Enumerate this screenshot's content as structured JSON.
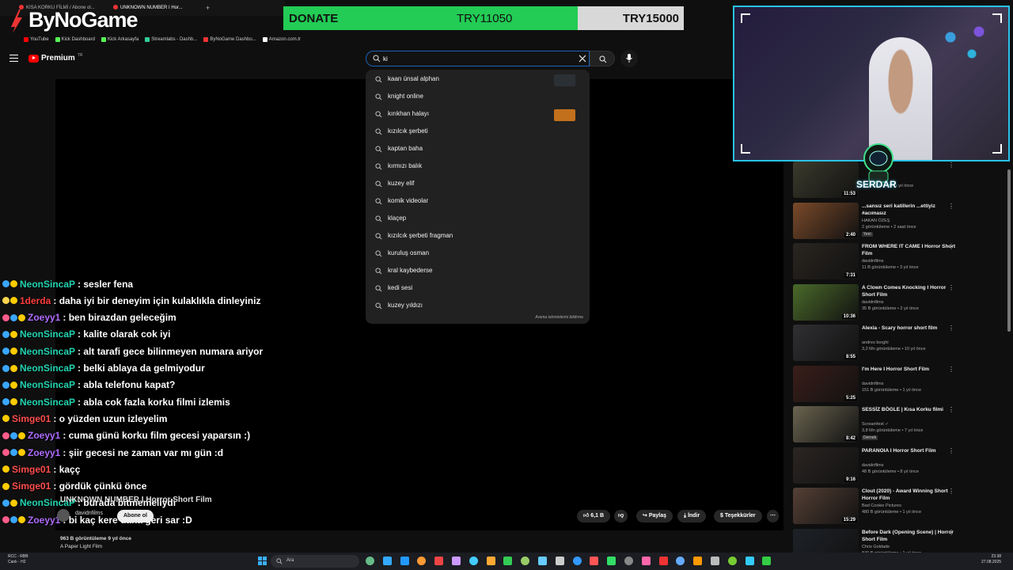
{
  "browser": {
    "tabs": [
      {
        "label": "KISA KORKU FİLMİ / Abone ol..."
      },
      {
        "label": "UNKNOWN NUMBER I Hor..."
      }
    ],
    "bookmarks": [
      "YouTube",
      "Kick Dashboard",
      "Kick Arkasayfa",
      "Streamlabs - Dashb...",
      "ByNoGame Dashbo...",
      "Amazon.com.tr"
    ]
  },
  "overlay": {
    "logo_text": "ByNoGame",
    "donate_label": "DONATE",
    "donate_current": "TRY11050",
    "donate_goal": "TRY15000",
    "donate_progress": 0.736,
    "streamer_badge": "SERDAR"
  },
  "youtube": {
    "logo_text": "Premium",
    "logo_region": "TR",
    "search_value": "ki",
    "suggestions": [
      {
        "text": "kaan ünsal alphan",
        "thumb": "#2a3034"
      },
      {
        "text": "knight online",
        "thumb": ""
      },
      {
        "text": "kırıkhan halayı",
        "thumb": "#c2701c"
      },
      {
        "text": "kızılcık şerbeti",
        "thumb": ""
      },
      {
        "text": "kaptan baha",
        "thumb": ""
      },
      {
        "text": "kırmızı balık",
        "thumb": ""
      },
      {
        "text": "kuzey elif",
        "thumb": ""
      },
      {
        "text": "komik videolar",
        "thumb": ""
      },
      {
        "text": "klaçep",
        "thumb": ""
      },
      {
        "text": "kızılcık şerbeti fragman",
        "thumb": ""
      },
      {
        "text": "kuruluş osman",
        "thumb": ""
      },
      {
        "text": "kral kaybederse",
        "thumb": ""
      },
      {
        "text": "kedi sesi",
        "thumb": ""
      },
      {
        "text": "kuzey yıldızı",
        "thumb": ""
      }
    ],
    "suggest_footer": "Arama tahminlerini bildirme",
    "video": {
      "title": "UNKNOWN NUMBER I Horror Short Film",
      "channel": "davidnfilms",
      "subscribe_label": "Abone ol",
      "likes": "6,1 B",
      "share_label": "Paylaş",
      "download_label": "İndir",
      "thanks_label": "Teşekkürler",
      "views_age": "963 B görüntüleme  9 yıl önce",
      "description": "A Paper Light Film"
    }
  },
  "chat": [
    {
      "user": "NeonSincaP",
      "color": "#22d3b0",
      "text": ": sesler fena",
      "badges": [
        "#3aa7ff",
        "#ffcc00"
      ]
    },
    {
      "user": "1derda",
      "color": "#ff3b3b",
      "text": ": daha iyi bir deneyim için kulaklıkla dinleyiniz",
      "badges": [
        "#ffd54f",
        "#ffcc00"
      ]
    },
    {
      "user": "Zoeyy1",
      "color": "#b06cff",
      "text": ": ben birazdan geleceğim",
      "badges": [
        "#ff5c8a",
        "#3aa7ff",
        "#ffcc00"
      ]
    },
    {
      "user": "NeonSincaP",
      "color": "#22d3b0",
      "text": ": kalite olarak cok iyi",
      "badges": [
        "#3aa7ff",
        "#ffcc00"
      ]
    },
    {
      "user": "NeonSincaP",
      "color": "#22d3b0",
      "text": ": alt tarafi gece bilinmeyen numara ariyor",
      "badges": [
        "#3aa7ff",
        "#ffcc00"
      ]
    },
    {
      "user": "NeonSincaP",
      "color": "#22d3b0",
      "text": ": belki ablaya da gelmiyodur",
      "badges": [
        "#3aa7ff",
        "#ffcc00"
      ]
    },
    {
      "user": "NeonSincaP",
      "color": "#22d3b0",
      "text": ": abla telefonu kapat?",
      "badges": [
        "#3aa7ff",
        "#ffcc00"
      ]
    },
    {
      "user": "NeonSincaP",
      "color": "#22d3b0",
      "text": ": abla cok fazla korku filmi izlemis",
      "badges": [
        "#3aa7ff",
        "#ffcc00"
      ]
    },
    {
      "user": "Simge01",
      "color": "#ff4d4d",
      "text": ": o yüzden uzun izleyelim",
      "badges": [
        "#ffcc00"
      ]
    },
    {
      "user": "Zoeyy1",
      "color": "#b06cff",
      "text": ": cuma günü korku film gecesi yaparsın :)",
      "badges": [
        "#ff5c8a",
        "#3aa7ff",
        "#ffcc00"
      ]
    },
    {
      "user": "Zoeyy1",
      "color": "#b06cff",
      "text": ": şiir gecesi ne zaman var mı gün :d",
      "badges": [
        "#ff5c8a",
        "#3aa7ff",
        "#ffcc00"
      ]
    },
    {
      "user": "Simge01",
      "color": "#ff4d4d",
      "text": ": kaçç",
      "badges": [
        "#ffcc00"
      ]
    },
    {
      "user": "Simge01",
      "color": "#ff4d4d",
      "text": ": gördük çünkü önce",
      "badges": [
        "#ffcc00"
      ]
    },
    {
      "user": "NeonSincaP",
      "color": "#22d3b0",
      "text": ": burada bitmemeliydi",
      "badges": [
        "#3aa7ff",
        "#ffcc00"
      ]
    },
    {
      "user": "Zoeyy1",
      "color": "#b06cff",
      "text": ": bi kaç kere daha geri sar :D",
      "badges": [
        "#ff5c8a",
        "#3aa7ff",
        "#ffcc00"
      ]
    }
  ],
  "sidebar": {
    "recs": [
      {
        "title": "",
        "channel": "",
        "meta": "... görüntüleme • 5 yıl önce",
        "duration": "11:53",
        "thumb": "#3b3a2c",
        "tag": ""
      },
      {
        "title": "...sansız seri katillerin ...ettiyiz #acımasız",
        "channel": "HAKAN ÖZEŞ",
        "meta": "2 görüntüleme • 2 saat önce",
        "duration": "2:40",
        "thumb": "#7a4a2a",
        "tag": "Yeni"
      },
      {
        "title": "FROM WHERE IT CAME I Horror Short Film",
        "channel": "davidnfilms",
        "meta": "11 B görüntüleme • 3 yıl önce",
        "duration": "7:31",
        "thumb": "#2a2520",
        "tag": ""
      },
      {
        "title": "A Clown Comes Knocking I Horror Short Film",
        "channel": "davidnfilms",
        "meta": "35 B görüntüleme • 2 yıl önce",
        "duration": "10:36",
        "thumb": "#4a6a2a",
        "tag": ""
      },
      {
        "title": "Alexia - Scary horror short film",
        "channel": "andres borghi",
        "meta": "3,2 Mn görüntüleme • 10 yıl önce",
        "duration": "8:55",
        "thumb": "#303033",
        "tag": ""
      },
      {
        "title": "I'm Here I Horror Short Film",
        "channel": "davidnfilms",
        "meta": "151 B görüntüleme • 1 yıl önce",
        "duration": "5:25",
        "thumb": "#3a1e1a",
        "tag": ""
      },
      {
        "title": "SESSİZ BÖGLE | Kısa Korku filmi",
        "channel": "Screamfest ✓",
        "meta": "3,8 Mn görüntüleme • 7 yıl önce",
        "duration": "8:42",
        "thumb": "#6a6450",
        "tag": "Dernek"
      },
      {
        "title": "PARANOIA I Horror Short Film",
        "channel": "davidnfilms",
        "meta": "48 B görüntüleme • 8 yıl önce",
        "duration": "9:16",
        "thumb": "#2b2523",
        "tag": ""
      },
      {
        "title": "Clout (2020) - Award Winning Short Horror Film",
        "channel": "Bad Cookie Pictures",
        "meta": "480 B görüntüleme • 1 yıl önce",
        "duration": "15:29",
        "thumb": "#554035",
        "tag": ""
      },
      {
        "title": "Before Dark (Opening Scene) | Horror Short Film",
        "channel": "Chris Goldade",
        "meta": "849 B görüntüleme • 1 yıl önce",
        "duration": "12:04",
        "thumb": "#1e2228",
        "tag": ""
      }
    ]
  },
  "taskbar": {
    "weather_line1": "RCC - RBB",
    "weather_line2": "Canlı - H2",
    "search_placeholder": "Ara",
    "time": "23:38",
    "date": "27.08.2025"
  }
}
